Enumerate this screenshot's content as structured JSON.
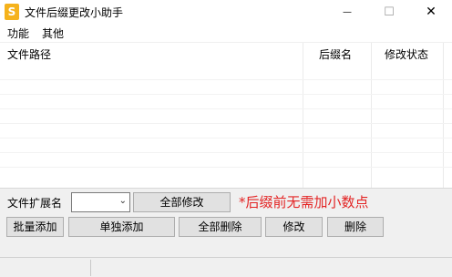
{
  "window": {
    "title": "文件后缀更改小助手",
    "icon_letter": "S",
    "minimize_glyph": "—",
    "maximize_glyph": "☐",
    "close_glyph": "✕"
  },
  "menu": {
    "items": [
      "功能",
      "其他"
    ]
  },
  "list": {
    "columns": [
      "文件路径",
      "后缀名",
      "修改状态"
    ],
    "rows": []
  },
  "controls": {
    "ext_label": "文件扩展名",
    "ext_value": "",
    "modify_all": "全部修改",
    "note": "*后缀前无需加小数点",
    "batch_add": "批量添加",
    "single_add": "单独添加",
    "delete_all": "全部删除",
    "modify": "修改",
    "delete": "删除"
  },
  "status": {
    "segments": [
      "",
      ""
    ]
  },
  "colors": {
    "note": "#e32424",
    "icon_bg": "#f5b21b"
  }
}
